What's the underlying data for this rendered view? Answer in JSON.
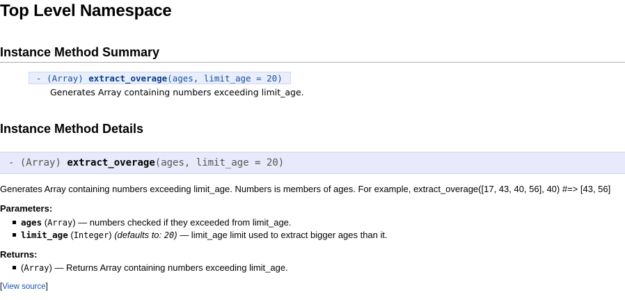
{
  "page": {
    "title": "Top Level Namespace"
  },
  "summary": {
    "heading": "Instance Method Summary",
    "method": {
      "dash": "-",
      "return_type": "(Array)",
      "name": "extract_overage",
      "args": "(ages, limit_age = 20)",
      "description": "Generates Array containing numbers exceeding limit_age."
    }
  },
  "details": {
    "heading": "Instance Method Details",
    "signature": {
      "dash": "-",
      "return_type": "(Array)",
      "name": "extract_overage",
      "args": "(ages, limit_age = 20)"
    },
    "description": "Generates Array containing numbers exceeding limit_age. Numbers is members of ages. For example, extract_overage([17, 43, 40, 56], 40) #=> [43, 56]",
    "parameters_heading": "Parameters:",
    "parameters": [
      {
        "name": "ages",
        "type": "Array",
        "defaults": "",
        "text": "— numbers checked if they exceeded from limit_age."
      },
      {
        "name": "limit_age",
        "type": "Integer",
        "defaults_label": "(defaults to: ",
        "defaults_value": "20",
        "defaults_close": ")",
        "text": "— limit_age limit used to extract bigger ages than it."
      }
    ],
    "returns_heading": "Returns:",
    "returns": {
      "type": "Array",
      "text": "— Returns Array containing numbers exceeding limit_age."
    },
    "source": {
      "open": "[",
      "label": "View source",
      "close": "]"
    }
  }
}
